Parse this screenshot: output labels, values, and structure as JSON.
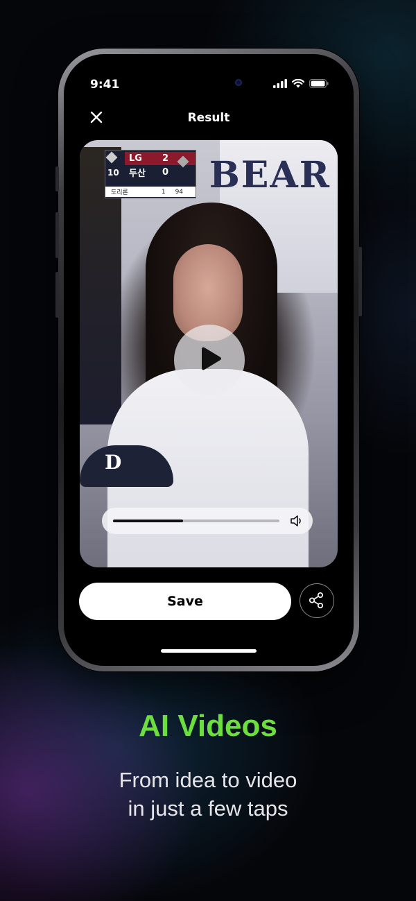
{
  "status": {
    "time": "9:41"
  },
  "header": {
    "title": "Result"
  },
  "video": {
    "scoreboard": {
      "team1": "LG",
      "score1": "2",
      "team2": "두산",
      "score2": "0",
      "inning": "10",
      "batter": "도리론",
      "batter_no": "1",
      "pitch_count": "94"
    },
    "jersey_text": "BEAR",
    "cap_letter": "D",
    "progress": 0.42
  },
  "actions": {
    "save_label": "Save"
  },
  "promo": {
    "headline": "AI Videos",
    "subline1": "From idea to video",
    "subline2": "in just a few taps"
  },
  "colors": {
    "accent": "#6dde3f",
    "background": "#05060a"
  }
}
